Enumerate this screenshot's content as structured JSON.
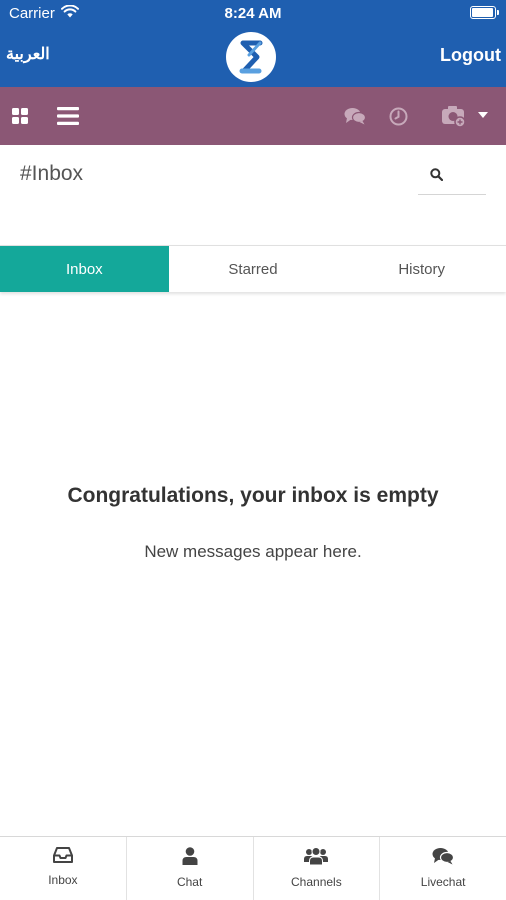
{
  "status_bar": {
    "carrier": "Carrier",
    "time": "8:24 AM",
    "battery_level": 1.0
  },
  "app_bar": {
    "language_link": "العربية",
    "logout_label": "Logout"
  },
  "toolbar": {
    "icons": [
      "grid-icon",
      "menu-icon",
      "chat-bubbles-icon",
      "clock-icon",
      "camera-icon",
      "caret-down-icon"
    ]
  },
  "page": {
    "title": "#Inbox"
  },
  "tabs": [
    {
      "label": "Inbox",
      "active": true
    },
    {
      "label": "Starred",
      "active": false
    },
    {
      "label": "History",
      "active": false
    }
  ],
  "empty_state": {
    "title": "Congratulations, your inbox is empty",
    "subtitle": "New messages appear here."
  },
  "bottom_nav": [
    {
      "label": "Inbox",
      "icon": "inbox-tray-icon"
    },
    {
      "label": "Chat",
      "icon": "user-icon"
    },
    {
      "label": "Channels",
      "icon": "users-group-icon"
    },
    {
      "label": "Livechat",
      "icon": "chat-bubbles-icon"
    }
  ],
  "colors": {
    "header_blue": "#1f5fb0",
    "toolbar_purple": "#8b5775",
    "active_tab_teal": "#14a89a"
  }
}
